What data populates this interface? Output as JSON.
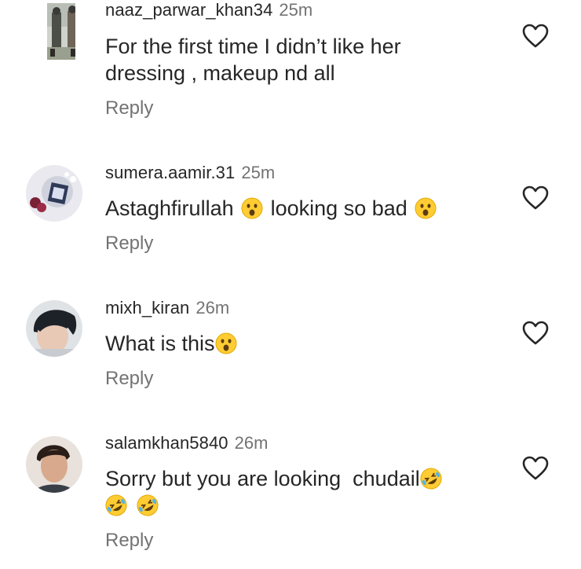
{
  "comments": [
    {
      "username": "naaz_parwar_khan34",
      "time": "25m",
      "text_line1": "For the first time I didn’t like her",
      "text_line2": "dressing , makeup nd all",
      "reply": "Reply"
    },
    {
      "username": "sumera.aamir.31",
      "time": "25m",
      "text_part1": "Astaghfirullah",
      "text_part2": "looking so bad",
      "reply": "Reply"
    },
    {
      "username": "mixh_kiran",
      "time": "26m",
      "text": "What is this",
      "reply": "Reply"
    },
    {
      "username": "salamkhan5840",
      "time": "26m",
      "text": "Sorry but you are looking  chudail",
      "reply": "Reply"
    }
  ],
  "icons": {
    "like": "heart-outline-icon",
    "surprised": "face-with-open-mouth-emoji",
    "laughing": "rolling-on-floor-laughing-emoji"
  },
  "colors": {
    "username": "#262626",
    "secondary": "#737373",
    "emoji_yellow": "#ffcc33"
  }
}
